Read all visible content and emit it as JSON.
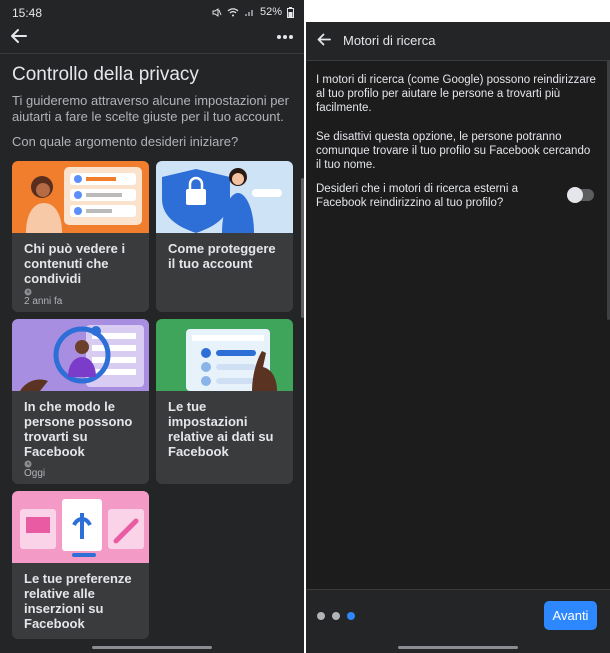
{
  "left": {
    "status": {
      "time": "15:48",
      "battery": "52%"
    },
    "title": "Controllo della privacy",
    "subtitle": "Ti guideremo attraverso alcune impostazioni per aiutarti a fare le scelte giuste per il tuo account.",
    "question": "Con quale argomento desideri iniziare?",
    "cards": [
      {
        "label": "Chi può vedere i contenuti che condividi",
        "meta": "2 anni fa"
      },
      {
        "label": "Come proteggere il tuo account",
        "meta": ""
      },
      {
        "label": "In che modo le persone possono trovarti su Facebook",
        "meta": "Oggi"
      },
      {
        "label": "Le tue impostazioni relative ai dati su Facebook",
        "meta": ""
      },
      {
        "label": "Le tue preferenze relative alle inserzioni su Facebook",
        "meta": ""
      }
    ]
  },
  "right": {
    "title": "Motori di ricerca",
    "para1": "I motori di ricerca (come Google) possono reindirizzare al tuo profilo per aiutare le persone a trovarti più facilmente.",
    "para2": "Se disattivi questa opzione, le persone potranno comunque trovare il tuo profilo su Facebook cercando il tuo nome.",
    "question": "Desideri che i motori di ricerca esterni a Facebook reindirizzino al tuo profilo?",
    "toggle_on": false,
    "pager": {
      "count": 3,
      "active": 3
    },
    "next_label": "Avanti"
  },
  "colors": {
    "accent": "#2d88ff",
    "background": "#242526",
    "card": "#3a3b3c"
  },
  "icons": [
    "back-arrow-icon",
    "more-icon",
    "clock-icon",
    "battery-icon",
    "wifi-icon",
    "mute-icon"
  ]
}
